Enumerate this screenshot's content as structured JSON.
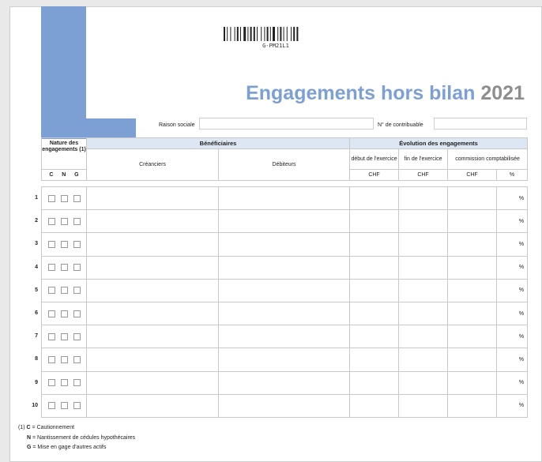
{
  "barcode_text": "G-PM21L1",
  "title": {
    "main": "Engagements hors bilan",
    "year": "2021"
  },
  "fields": {
    "raison_sociale": "Raison sociale",
    "no_contribuable": "N° de contribuable"
  },
  "table": {
    "nature_header": "Nature des engagements (1)",
    "nature_cols": [
      "C",
      "N",
      "G"
    ],
    "beneficiaires": "Bénéficiaires",
    "creanciers": "Créanciers",
    "debiteurs": "Débiteurs",
    "evolution": "Évolution des engagements",
    "debut": "début de l'exercice",
    "fin": "fin de l'exercice",
    "commission": "commission comptabilisée",
    "chf": "CHF",
    "pct": "%",
    "rows": [
      "1",
      "2",
      "3",
      "4",
      "5",
      "6",
      "7",
      "8",
      "9",
      "10"
    ]
  },
  "notes": {
    "ref": "(1)",
    "c_key": "C",
    "c_text": " = Cautionnement",
    "n_key": "N",
    "n_text": " = Nantissement de cédules hypothécaires",
    "g_key": "G",
    "g_text": " = Mise en gage d'autres actifs"
  }
}
